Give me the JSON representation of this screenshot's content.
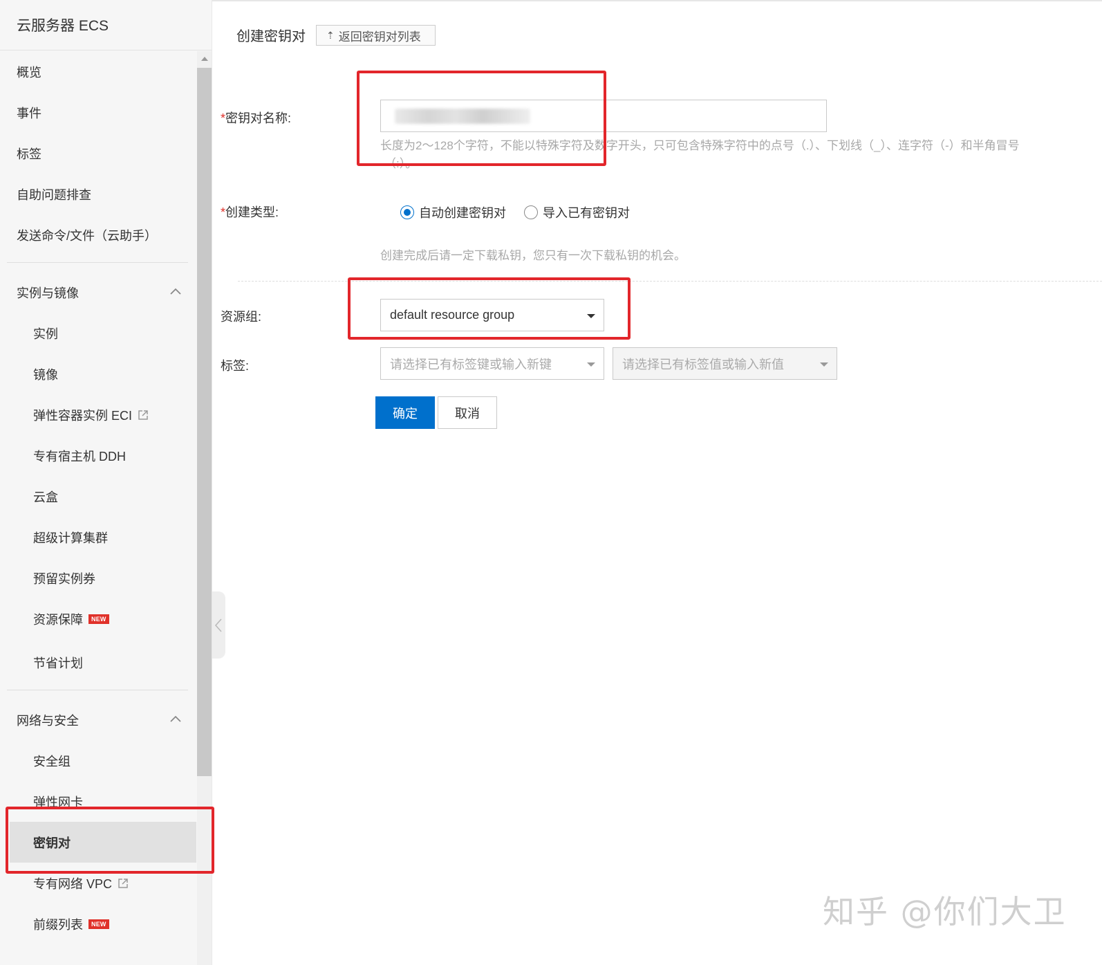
{
  "app": {
    "title": "云服务器 ECS"
  },
  "sidebar": {
    "top_items": [
      {
        "label": "概览"
      },
      {
        "label": "事件"
      },
      {
        "label": "标签"
      },
      {
        "label": "自助问题排查"
      },
      {
        "label": "发送命令/文件（云助手）"
      }
    ],
    "group_instances": {
      "label": "实例与镜像",
      "items": [
        {
          "label": "实例"
        },
        {
          "label": "镜像"
        },
        {
          "label": "弹性容器实例 ECI"
        },
        {
          "label": "专有宿主机 DDH"
        },
        {
          "label": "云盒"
        },
        {
          "label": "超级计算集群"
        },
        {
          "label": "预留实例券"
        },
        {
          "label": "资源保障"
        },
        {
          "label": "节省计划"
        }
      ]
    },
    "group_network": {
      "label": "网络与安全",
      "items": [
        {
          "label": "安全组"
        },
        {
          "label": "弹性网卡"
        },
        {
          "label": "密钥对"
        },
        {
          "label": "专有网络 VPC"
        },
        {
          "label": "前缀列表"
        }
      ]
    },
    "badge_new": "NEW"
  },
  "header": {
    "title": "创建密钥对",
    "back_label": "返回密钥对列表"
  },
  "form": {
    "required_mark": "*",
    "name": {
      "label": "密钥对名称:",
      "value": "",
      "hint_line1": "长度为2～128个字符，不能以特殊字符及数字开头，只可包含特殊字符中的点号（.）、下划线（_）、连字符（-）和半角冒号",
      "hint_line2": "（:）。"
    },
    "type": {
      "label": "创建类型:",
      "options": [
        {
          "label": "自动创建密钥对",
          "checked": true
        },
        {
          "label": "导入已有密钥对",
          "checked": false
        }
      ],
      "hint": "创建完成后请一定下载私钥，您只有一次下载私钥的机会。"
    },
    "resource_group": {
      "label": "资源组:",
      "value": "default resource group"
    },
    "tags": {
      "label": "标签:",
      "key_placeholder": "请选择已有标签键或输入新键",
      "value_placeholder": "请选择已有标签值或输入新值"
    },
    "confirm_label": "确定",
    "cancel_label": "取消"
  },
  "watermark": "知乎 @你们大卫",
  "colors": {
    "primary": "#0070cc",
    "highlight": "#e2262b",
    "accent": "#ff6a00",
    "new_badge": "#e0312a"
  }
}
